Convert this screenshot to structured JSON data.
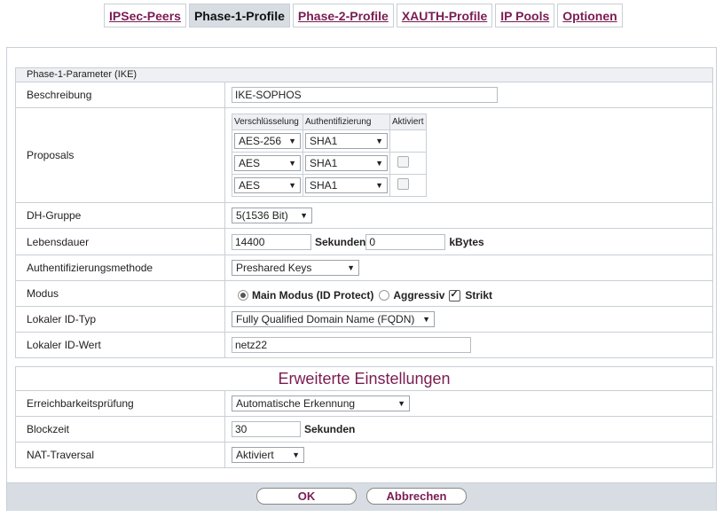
{
  "tabs": [
    {
      "label": "IPSec-Peers",
      "active": false
    },
    {
      "label": "Phase-1-Profile",
      "active": true
    },
    {
      "label": "Phase-2-Profile",
      "active": false
    },
    {
      "label": "XAUTH-Profile",
      "active": false
    },
    {
      "label": "IP Pools",
      "active": false
    },
    {
      "label": "Optionen",
      "active": false
    }
  ],
  "section1": {
    "header": "Phase-1-Parameter (IKE)",
    "beschreibung": {
      "label": "Beschreibung",
      "value": "IKE-SOPHOS"
    },
    "proposals": {
      "label": "Proposals",
      "headers": [
        "Verschlüsselung",
        "Authentifizierung",
        "Aktiviert"
      ],
      "rows": [
        {
          "enc": "AES-256",
          "auth": "SHA1",
          "activated": null
        },
        {
          "enc": "AES",
          "auth": "SHA1",
          "activated": false
        },
        {
          "enc": "AES",
          "auth": "SHA1",
          "activated": false
        }
      ]
    },
    "dh": {
      "label": "DH-Gruppe",
      "value": "5(1536 Bit)"
    },
    "lifetime": {
      "label": "Lebensdauer",
      "seconds": "14400",
      "seconds_unit": "Sekunden",
      "kbytes": "0",
      "kbytes_unit": "kBytes"
    },
    "authmethod": {
      "label": "Authentifizierungsmethode",
      "value": "Preshared Keys"
    },
    "mode": {
      "label": "Modus",
      "main": "Main Modus (ID Protect)",
      "aggressive": "Aggressiv",
      "strict": "Strikt",
      "selected": "main",
      "strict_checked": true
    },
    "local_id_type": {
      "label": "Lokaler ID-Typ",
      "value": "Fully Qualified Domain Name (FQDN)"
    },
    "local_id_value": {
      "label": "Lokaler ID-Wert",
      "value": "netz22"
    }
  },
  "section2": {
    "title": "Erweiterte Einstellungen",
    "reachability": {
      "label": "Erreichbarkeitsprüfung",
      "value": "Automatische Erkennung"
    },
    "blocktime": {
      "label": "Blockzeit",
      "value": "30",
      "unit": "Sekunden"
    },
    "nat": {
      "label": "NAT-Traversal",
      "value": "Aktiviert"
    }
  },
  "buttons": {
    "ok": "OK",
    "cancel": "Abbrechen"
  },
  "colors": {
    "accent": "#7a1c52",
    "border": "#c9cfd6",
    "header_bg": "#eef0f3",
    "bar_bg": "#d7dde3"
  }
}
